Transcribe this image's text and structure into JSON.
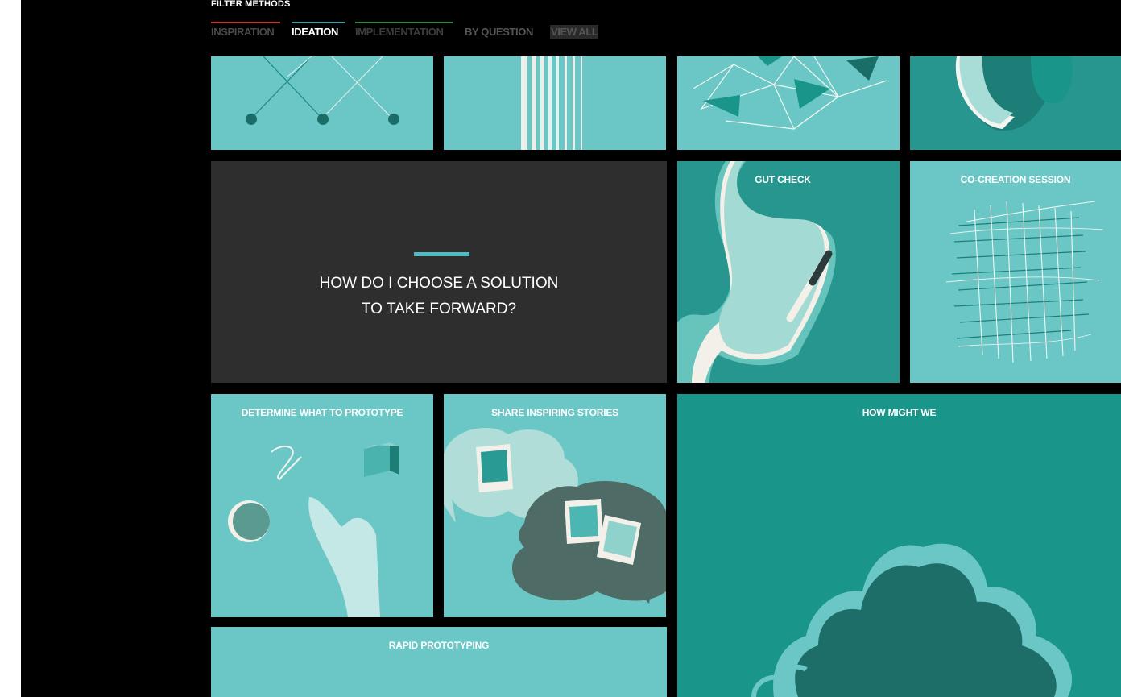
{
  "filter": {
    "title": "FILTER METHODS",
    "tabs": [
      {
        "label": "INSPIRATION",
        "color": "#c0392b"
      },
      {
        "label": "IDEATION",
        "color": "#3a9fa3"
      },
      {
        "label": "IMPLEMENTATION",
        "color": "#2e8b3e"
      },
      {
        "label": "BY QUESTION"
      },
      {
        "label": "VIEW ALL"
      }
    ]
  },
  "question": {
    "line1": "HOW DO I CHOOSE A SOLUTION",
    "line2": "TO TAKE FORWARD?"
  },
  "methods": {
    "gut_check": "GUT CHECK",
    "co_creation": "CO-CREATION SESSION",
    "determine": "DETERMINE WHAT TO PROTOTYPE",
    "share": "SHARE INSPIRING STORIES",
    "hmw": "HOW MIGHT WE",
    "rapid": "RAPID PROTOTYPING"
  },
  "colors": {
    "light_teal": "#6ac7c6",
    "dark_teal": "#26968f",
    "deep_teal": "#1a958a",
    "question_bg": "#2e2e2e",
    "accent": "#4ebcc0"
  }
}
